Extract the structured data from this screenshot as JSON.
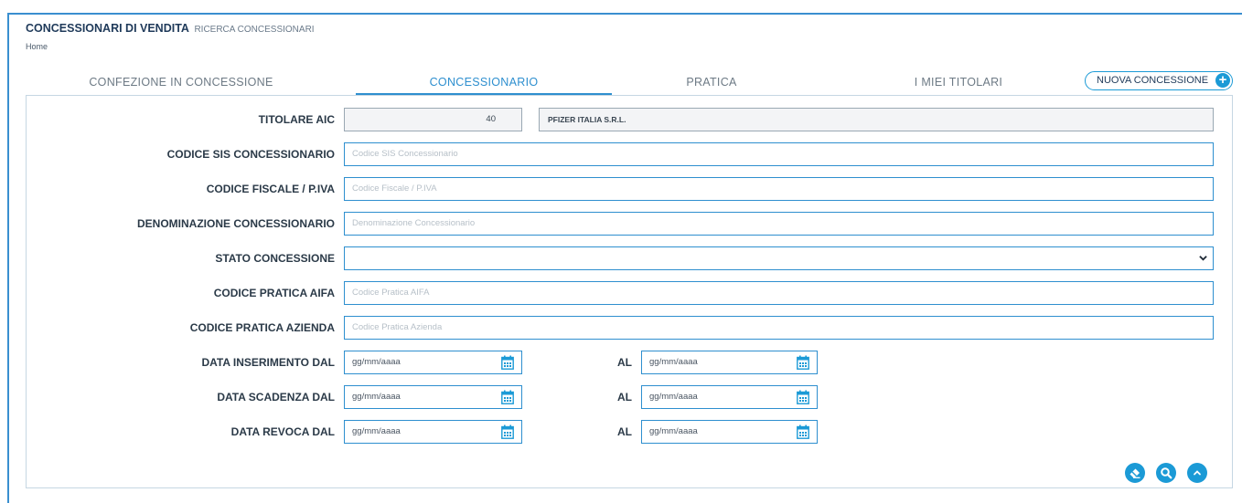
{
  "header": {
    "title": "CONCESSIONARI DI VENDITA",
    "subtitle": "RICERCA CONCESSIONARI",
    "breadcrumb": "Home"
  },
  "tabs": [
    {
      "label": "CONFEZIONE IN CONCESSIONE"
    },
    {
      "label": "CONCESSIONARIO",
      "active": true
    },
    {
      "label": "PRATICA"
    },
    {
      "label": "I MIEI TITOLARI"
    }
  ],
  "new_button_label": "NUOVA CONCESSIONE",
  "form": {
    "titolare": {
      "label": "TITOLARE AIC",
      "code": "40",
      "name": "PFIZER ITALIA S.R.L."
    },
    "codice_sis": {
      "label": "CODICE SIS CONCESSIONARIO",
      "placeholder": "Codice SIS Concessionario"
    },
    "codice_fiscale": {
      "label": "CODICE FISCALE / P.IVA",
      "placeholder": "Codice Fiscale / P.IVA"
    },
    "denominazione": {
      "label": "DENOMINAZIONE CONCESSIONARIO",
      "placeholder": "Denominazione Concessionario"
    },
    "stato": {
      "label": "STATO CONCESSIONE",
      "value": ""
    },
    "codice_pratica_aifa": {
      "label": "CODICE PRATICA AIFA",
      "placeholder": "Codice Pratica AIFA"
    },
    "codice_pratica_azienda": {
      "label": "CODICE PRATICA AZIENDA",
      "placeholder": "Codice Pratica Azienda"
    },
    "al_label": "AL",
    "date_placeholder": "gg/mm/aaaa",
    "data_inserimento": {
      "label": "DATA INSERIMENTO DAL"
    },
    "data_scadenza": {
      "label": "DATA SCADENZA DAL"
    },
    "data_revoca": {
      "label": "DATA REVOCA DAL"
    }
  },
  "actions": [
    "eraser-icon",
    "search-icon",
    "chevron-up-icon"
  ],
  "colors": {
    "accent": "#1b9ad6",
    "active_tab": "#2e8fcf",
    "frame": "#3a8fd0"
  }
}
